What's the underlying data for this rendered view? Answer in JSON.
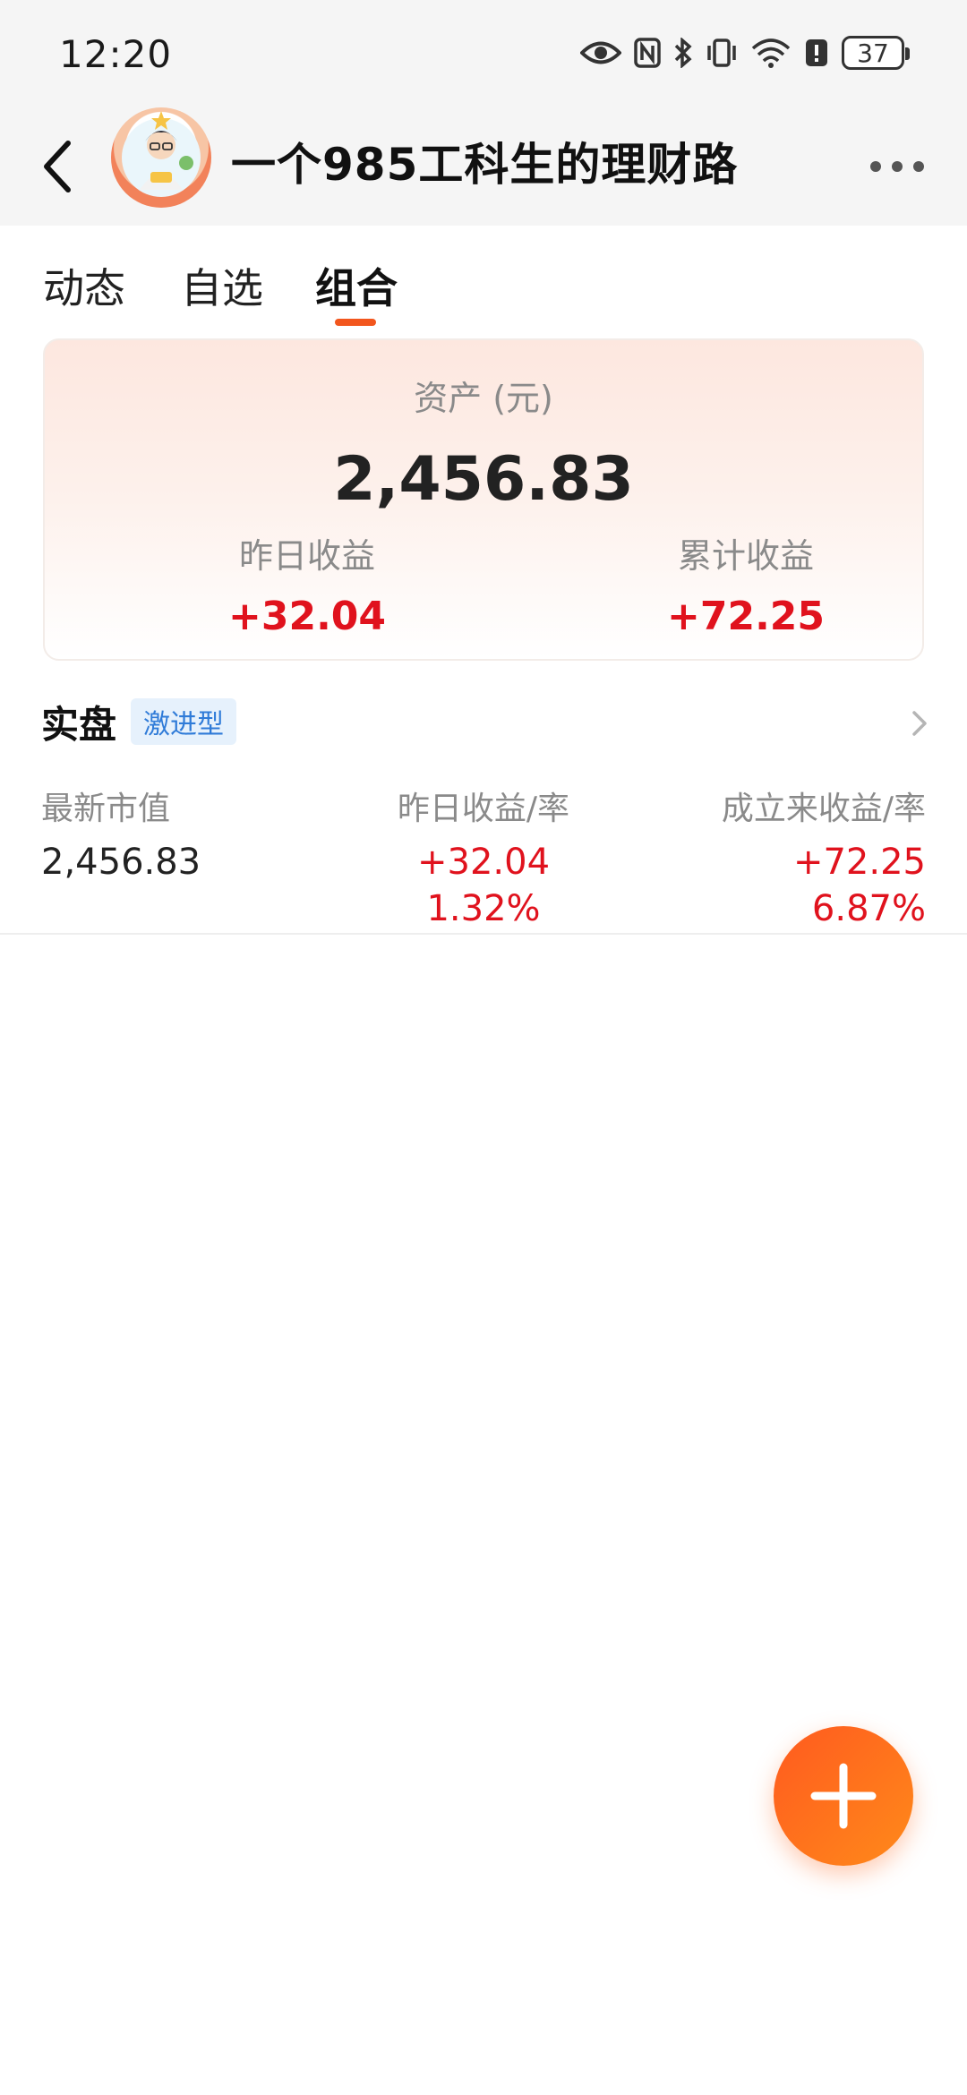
{
  "status_bar": {
    "time": "12:20",
    "battery": "37",
    "icons": [
      "eye-icon",
      "nfc-icon",
      "bluetooth-icon",
      "vibrate-icon",
      "wifi-icon",
      "alert-icon",
      "battery-icon"
    ]
  },
  "header": {
    "title": "一个985工科生的理财路",
    "back_icon": "chevron-left-icon",
    "more_icon": "more-dots-icon"
  },
  "tabs": [
    {
      "label": "动态",
      "active": false
    },
    {
      "label": "自选",
      "active": false
    },
    {
      "label": "组合",
      "active": true
    }
  ],
  "asset_card": {
    "label": "资产 (元)",
    "value": "2,456.83",
    "yesterday_label": "昨日收益",
    "yesterday_value": "+32.04",
    "total_label": "累计收益",
    "total_value": "+72.25"
  },
  "portfolio": {
    "title": "实盘",
    "tag": "激进型",
    "market_value_label": "最新市值",
    "market_value": "2,456.83",
    "yesterday_label": "昨日收益/率",
    "yesterday_value": "+32.04",
    "yesterday_rate": "1.32%",
    "since_label": "成立来收益/率",
    "since_value": "+72.25",
    "since_rate": "6.87%"
  },
  "fab": {
    "icon": "plus-icon"
  },
  "colors": {
    "accent": "#f2561d",
    "gain": "#e0121d",
    "tag_text": "#2f7bd8",
    "tag_bg": "#e6f1fc"
  }
}
